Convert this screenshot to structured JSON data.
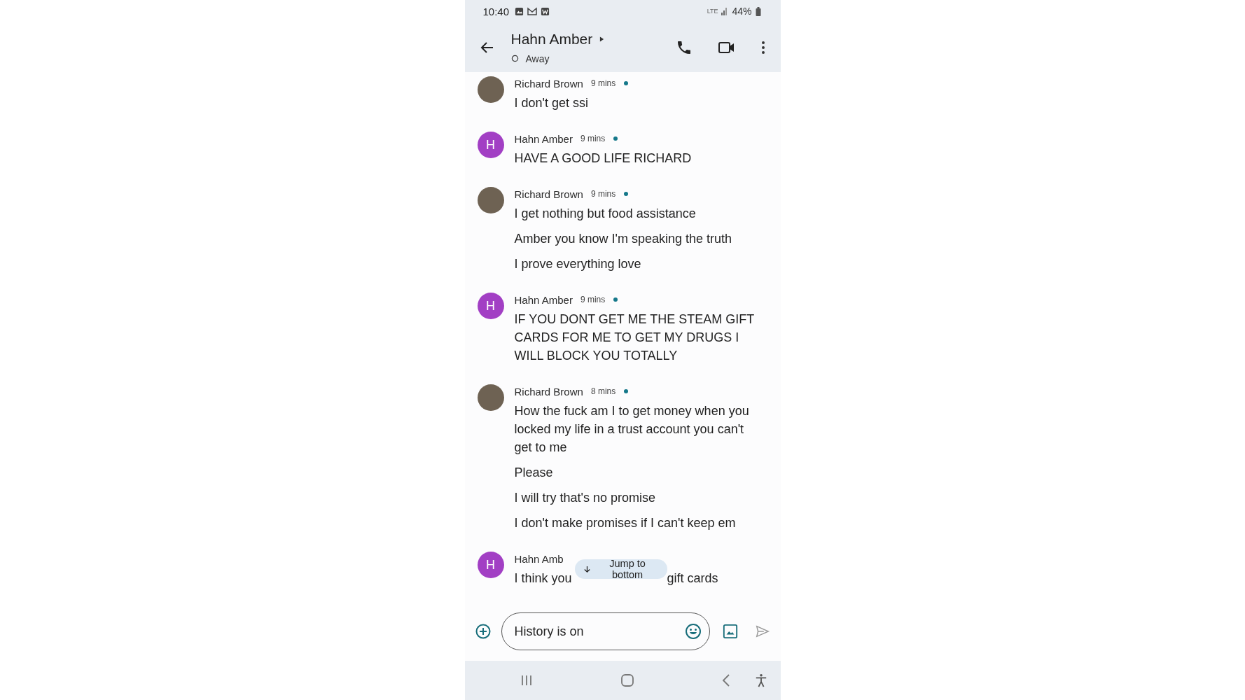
{
  "status_bar": {
    "time": "10:40",
    "network": "LTE",
    "battery": "44%"
  },
  "header": {
    "title": "Hahn Amber",
    "status": "Away"
  },
  "groups": [
    {
      "sender": "Richard Brown",
      "avatar": {
        "kind": "photo"
      },
      "time": "9 mins",
      "dot": true,
      "messages": [
        "I don't get ssi"
      ]
    },
    {
      "sender": "Hahn Amber",
      "avatar": {
        "kind": "letter",
        "letter": "H",
        "color": "#a23fc4"
      },
      "time": "9 mins",
      "dot": true,
      "messages": [
        "HAVE A GOOD LIFE RICHARD"
      ]
    },
    {
      "sender": "Richard Brown",
      "avatar": {
        "kind": "photo"
      },
      "time": "9 mins",
      "dot": true,
      "messages": [
        "I get nothing but food assistance",
        "Amber you know I'm speaking the truth",
        "I prove everything love"
      ]
    },
    {
      "sender": "Hahn Amber",
      "avatar": {
        "kind": "letter",
        "letter": "H",
        "color": "#a23fc4"
      },
      "time": "9 mins",
      "dot": true,
      "messages": [
        "IF YOU DONT GET ME THE STEAM GIFT CARDS FOR ME TO GET MY DRUGS I WILL BLOCK YOU TOTALLY"
      ]
    },
    {
      "sender": "Richard Brown",
      "avatar": {
        "kind": "photo"
      },
      "time": "8 mins",
      "dot": true,
      "messages": [
        "How the fuck am I to get money when you locked my life in a trust account you can't get to me",
        "Please",
        "I will try that's no promise",
        "I don't make promises if I can't keep em"
      ]
    },
    {
      "sender": "Hahn Amb",
      "avatar": {
        "kind": "letter",
        "letter": "H",
        "color": "#a23fc4"
      },
      "covered": true,
      "messages": [
        "I think you",
        "gift cards"
      ]
    }
  ],
  "jump_button": {
    "label": "Jump to bottom"
  },
  "composer": {
    "placeholder": "History is on"
  }
}
